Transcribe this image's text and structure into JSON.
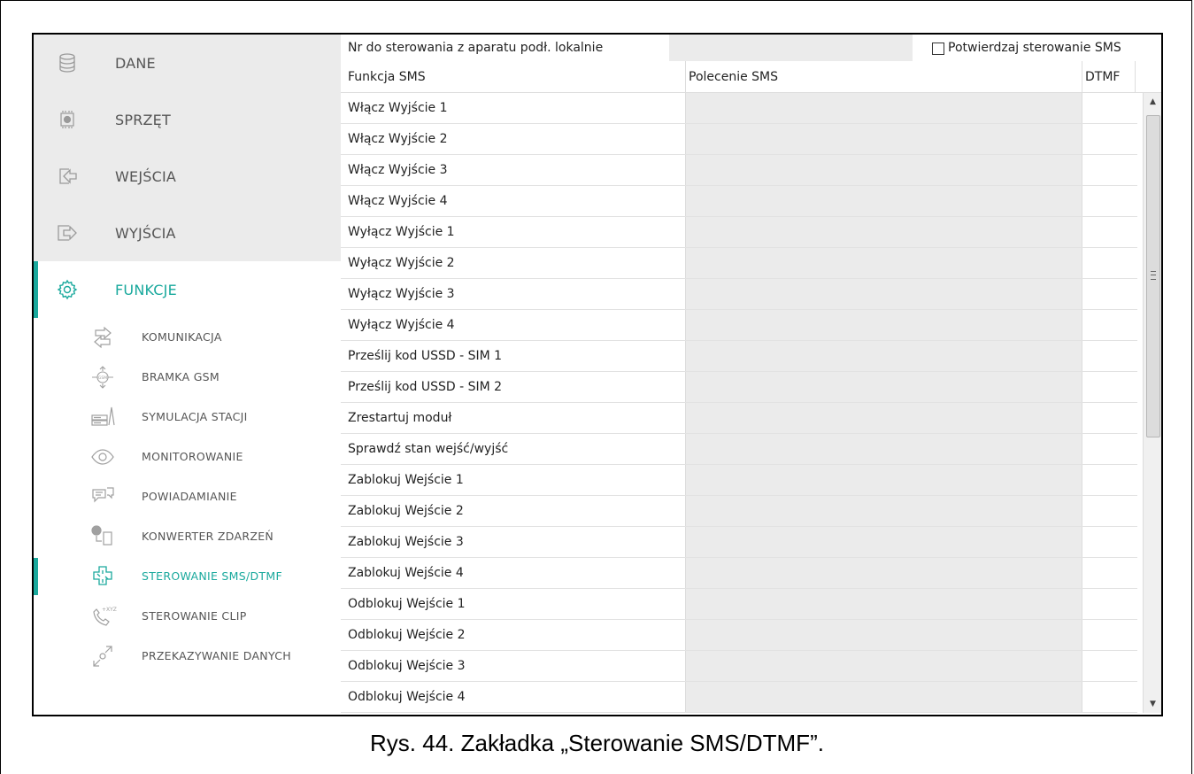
{
  "main_nav": [
    {
      "label": "DANE",
      "icon": "database-icon",
      "active": false
    },
    {
      "label": "SPRZĘT",
      "icon": "chip-icon",
      "active": false
    },
    {
      "label": "WEJŚCIA",
      "icon": "input-arrow-icon",
      "active": false
    },
    {
      "label": "WYJŚCIA",
      "icon": "output-arrow-icon",
      "active": false
    },
    {
      "label": "FUNKCJE",
      "icon": "gear-icon",
      "active": true
    }
  ],
  "sub_nav": [
    {
      "label": "KOMUNIKACJA",
      "icon": "exchange-arrows-icon",
      "active": false
    },
    {
      "label": "BRAMKA GSM",
      "icon": "gsm-gateway-icon",
      "active": false
    },
    {
      "label": "SYMULACJA STACJI",
      "icon": "station-simulation-icon",
      "active": false
    },
    {
      "label": "MONITOROWANIE",
      "icon": "eye-icon",
      "active": false
    },
    {
      "label": "POWIADAMIANIE",
      "icon": "chat-bubbles-icon",
      "active": false
    },
    {
      "label": "KONWERTER ZDARZEŃ",
      "icon": "event-converter-icon",
      "active": false
    },
    {
      "label": "STEROWANIE SMS/DTMF",
      "icon": "sms-control-icon",
      "active": true
    },
    {
      "label": "STEROWANIE CLIP",
      "icon": "phone-clip-icon",
      "active": false
    },
    {
      "label": "PRZEKAZYWANIE DANYCH",
      "icon": "data-transfer-icon",
      "active": false
    }
  ],
  "topbar": {
    "phone_label": "Nr do sterowania z aparatu podł. lokalnie",
    "phone_value": "",
    "confirm_label": "Potwierdzaj sterowanie SMS",
    "confirm_checked": false
  },
  "table": {
    "headers": [
      "Funkcja SMS",
      "Polecenie SMS",
      "DTMF"
    ],
    "rows": [
      "Włącz Wyjście 1",
      "Włącz Wyjście 2",
      "Włącz Wyjście 3",
      "Włącz Wyjście 4",
      "Wyłącz Wyjście 1",
      "Wyłącz Wyjście 2",
      "Wyłącz Wyjście 3",
      "Wyłącz Wyjście 4",
      "Prześlij kod USSD - SIM 1",
      "Prześlij kod USSD - SIM 2",
      "Zrestartuj moduł",
      "Sprawdź stan wejść/wyjść",
      "Zablokuj Wejście 1",
      "Zablokuj Wejście 2",
      "Zablokuj Wejście 3",
      "Zablokuj Wejście 4",
      "Odblokuj Wejście 1",
      "Odblokuj Wejście 2",
      "Odblokuj Wejście 3",
      "Odblokuj Wejście 4"
    ]
  },
  "caption": "Rys. 44. Zakładka „Sterowanie SMS/DTMF”.",
  "colors": {
    "accent": "#1aa99d",
    "nav_bg": "#ebebeb",
    "input_bg": "#ebebeb"
  }
}
